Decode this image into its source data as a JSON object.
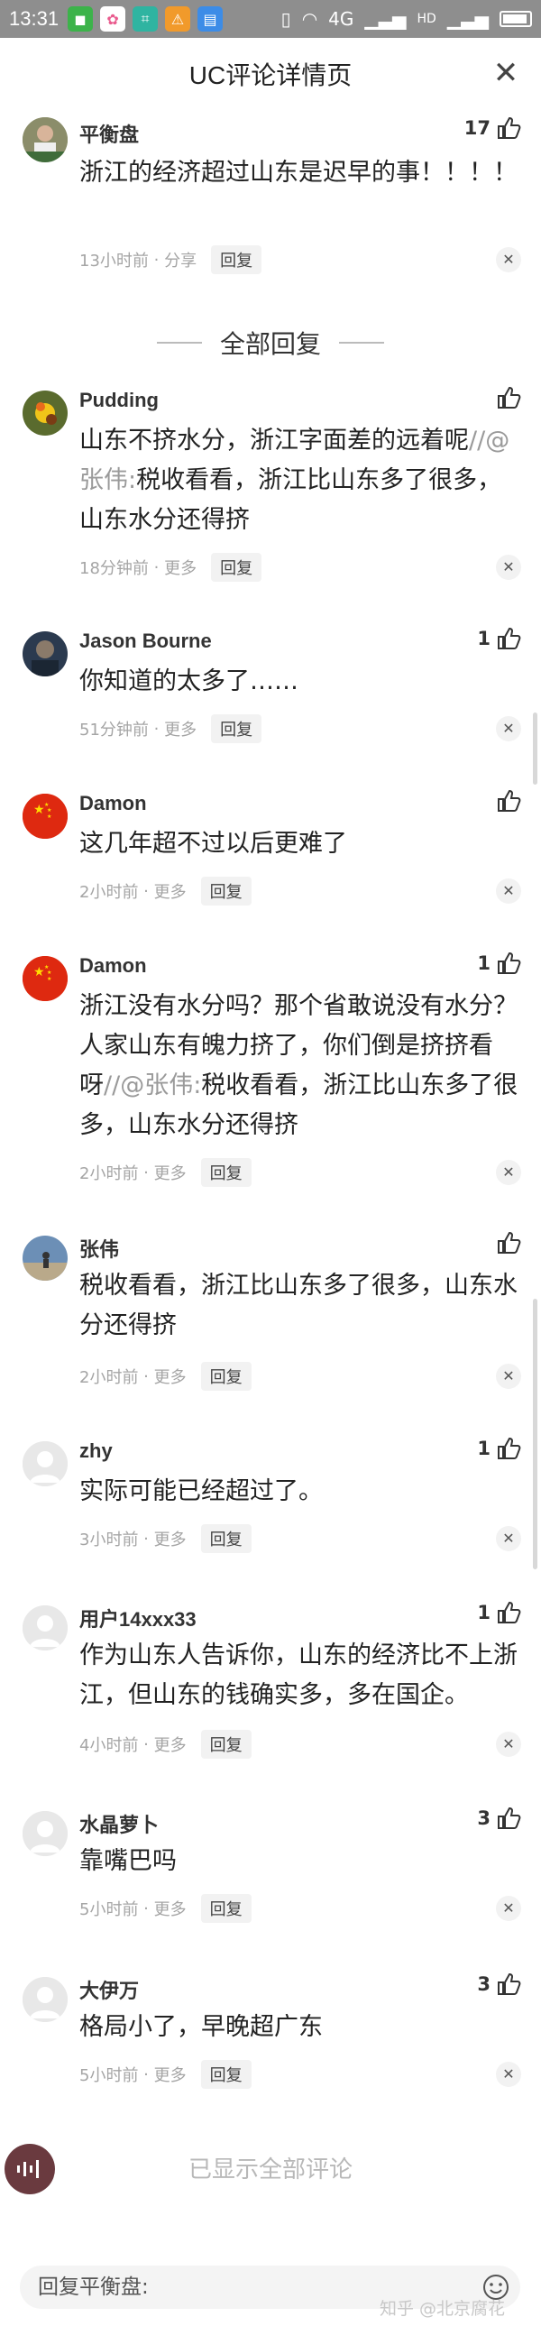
{
  "status_bar": {
    "time": "13:31",
    "network": "4G",
    "hd": "HD"
  },
  "header": {
    "title": "UC评论详情页"
  },
  "top_comment": {
    "user": "平衡盘",
    "likes": "17",
    "text": "浙江的经济超过山东是迟早的事！！！！",
    "time": "13小时前",
    "extra": "分享",
    "reply_label": "回复"
  },
  "section_title": "全部回复",
  "replies": [
    {
      "user": "Pudding",
      "likes": "",
      "text_main": "山东不挤水分，浙江字面差的远着呢",
      "quote_prefix": "//@张伟:",
      "text_quote": "税收看看，浙江比山东多了很多，山东水分还得挤",
      "time": "18分钟前",
      "extra": "更多",
      "reply_label": "回复"
    },
    {
      "user": "Jason Bourne",
      "likes": "1",
      "text_main": "你知道的太多了……",
      "time": "51分钟前",
      "extra": "更多",
      "reply_label": "回复"
    },
    {
      "user": "Damon",
      "likes": "",
      "text_main": "这几年超不过以后更难了",
      "time": "2小时前",
      "extra": "更多",
      "reply_label": "回复"
    },
    {
      "user": "Damon",
      "likes": "1",
      "text_main": "浙江没有水分吗？那个省敢说没有水分？人家山东有魄力挤了，你们倒是挤挤看呀",
      "quote_prefix": "//@张伟:",
      "text_quote": "税收看看，浙江比山东多了很多，山东水分还得挤",
      "time": "2小时前",
      "extra": "更多",
      "reply_label": "回复"
    },
    {
      "user": "张伟",
      "likes": "",
      "text_main": "税收看看，浙江比山东多了很多，山东水分还得挤",
      "time": "2小时前",
      "extra": "更多",
      "reply_label": "回复"
    },
    {
      "user": "zhy",
      "likes": "1",
      "text_main": "实际可能已经超过了。",
      "time": "3小时前",
      "extra": "更多",
      "reply_label": "回复"
    },
    {
      "user": "用户14xxx33",
      "likes": "1",
      "text_main": "作为山东人告诉你，山东的经济比不上浙江，但山东的钱确实多，多在国企。",
      "time": "4小时前",
      "extra": "更多",
      "reply_label": "回复"
    },
    {
      "user": "水晶萝卜",
      "likes": "3",
      "text_main": "靠嘴巴吗",
      "time": "5小时前",
      "extra": "更多",
      "reply_label": "回复"
    },
    {
      "user": "大伊万",
      "likes": "3",
      "text_main": "格局小了，早晚超广东",
      "time": "5小时前",
      "extra": "更多",
      "reply_label": "回复"
    }
  ],
  "footer": {
    "all_shown": "已显示全部评论",
    "reply_placeholder": "回复平衡盘:",
    "watermark": "知乎 @北京腐花"
  },
  "icons": {
    "close": "close-icon",
    "thumb": "thumbs-up-icon",
    "dismiss": "close-small-icon",
    "emoji": "smiley-icon"
  },
  "colors": {
    "status_bar_bg": "#8e8e8e",
    "meta_text": "#a5a5a5",
    "quote_text": "#9a9a9a"
  }
}
